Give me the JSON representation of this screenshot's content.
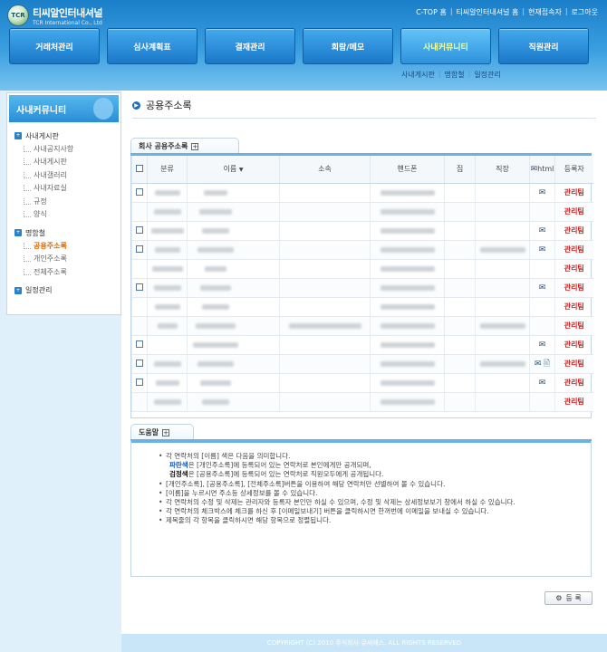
{
  "header": {
    "logo_mark": "TCR",
    "logo_name": "티씨알인터내셔널",
    "logo_sub": "TCR International Co., Ltd",
    "top_links": [
      "C-TOP 홈",
      "티씨알인터내셔널 홈",
      "현재접속자",
      "로그아웃"
    ],
    "gnb": [
      {
        "label": "거래처관리"
      },
      {
        "label": "심사계획표"
      },
      {
        "label": "결재관리"
      },
      {
        "label": "회람/메모"
      },
      {
        "label": "사내커뮤니티"
      },
      {
        "label": "직원관리"
      }
    ],
    "sub_nav": [
      "사내게시판",
      "명함철",
      "일정관리"
    ]
  },
  "sidebar": {
    "title": "사내커뮤니티",
    "groups": [
      {
        "label": "사내게시판",
        "items": [
          "사내공지사항",
          "사내게시판",
          "사내갤러리",
          "사내자료실",
          "규정",
          "양식"
        ]
      },
      {
        "label": "명함철",
        "items": [
          "공용주소록",
          "개인주소록",
          "전체주소록"
        ]
      },
      {
        "label": "일정관리",
        "items": []
      }
    ]
  },
  "main": {
    "title": "공용주소록",
    "section_tab": "회사 공용주소록",
    "table": {
      "headers": {
        "category": "분류",
        "name": "이름",
        "name_sort": "▼",
        "affiliation": "소속",
        "mobile": "핸드폰",
        "home": "집",
        "work": "직장",
        "email": "html",
        "registrant": "등록자"
      },
      "rows": [
        {
          "checkbox": true,
          "mail": true,
          "html": false,
          "registrant": "관리팀"
        },
        {
          "checkbox": false,
          "mail": false,
          "html": false,
          "registrant": "관리팀"
        },
        {
          "checkbox": true,
          "mail": true,
          "html": false,
          "registrant": "관리팀"
        },
        {
          "checkbox": true,
          "mail": true,
          "html": false,
          "registrant": "관리팀"
        },
        {
          "checkbox": false,
          "mail": false,
          "html": false,
          "registrant": "관리팀"
        },
        {
          "checkbox": true,
          "mail": true,
          "html": false,
          "registrant": "관리팀"
        },
        {
          "checkbox": false,
          "mail": false,
          "html": false,
          "registrant": "관리팀"
        },
        {
          "checkbox": false,
          "mail": false,
          "html": false,
          "registrant": "관리팀"
        },
        {
          "checkbox": true,
          "mail": true,
          "html": false,
          "registrant": "관리팀"
        },
        {
          "checkbox": true,
          "mail": true,
          "html": true,
          "registrant": "관리팀"
        },
        {
          "checkbox": true,
          "mail": true,
          "html": false,
          "registrant": "관리팀"
        },
        {
          "checkbox": false,
          "mail": false,
          "html": false,
          "registrant": "관리팀"
        }
      ]
    },
    "help_tab": "도움말",
    "help": [
      "각 연락처의 [이름] 색은 다음을 의미합니다.",
      "파란색은 [개인주소록]에 등록되어 있는 연락처로 본인에게만 공개되며,",
      "검정색은 [공용주소록]에 등록되어 있는 연락처로 직원모두에게 공개됩니다.",
      "[개인주소록], [공용주소록], [전체주소록]버튼을 이용하여 해당 연락처만 선별하여 볼 수 있습니다.",
      "[이름]을 누르시면 주소등 상세정보를 볼 수 있습니다.",
      "각 연락처의 수정 및 삭제는 관리자와 등록자 본인만 하실 수 있으며, 수정 및 삭제는 상세정보보기 창에서 하실 수 있습니다.",
      "각 연락처의 체크박스에 체크를 하신 후 [이메일보내기] 버튼을 클릭하시면 한꺼번에 이메일을 보내실 수 있습니다.",
      "제목줄의 각 항목을 클릭하시면 해당 항목으로 정렬됩니다."
    ],
    "help_blue_word": "파란색",
    "help_black_word": "검정색",
    "register_button": "등   록"
  },
  "footer": "COPYRIGHT (C) 2010 주식회사 큐씨에스. ALL RIGHTS RESERVED"
}
